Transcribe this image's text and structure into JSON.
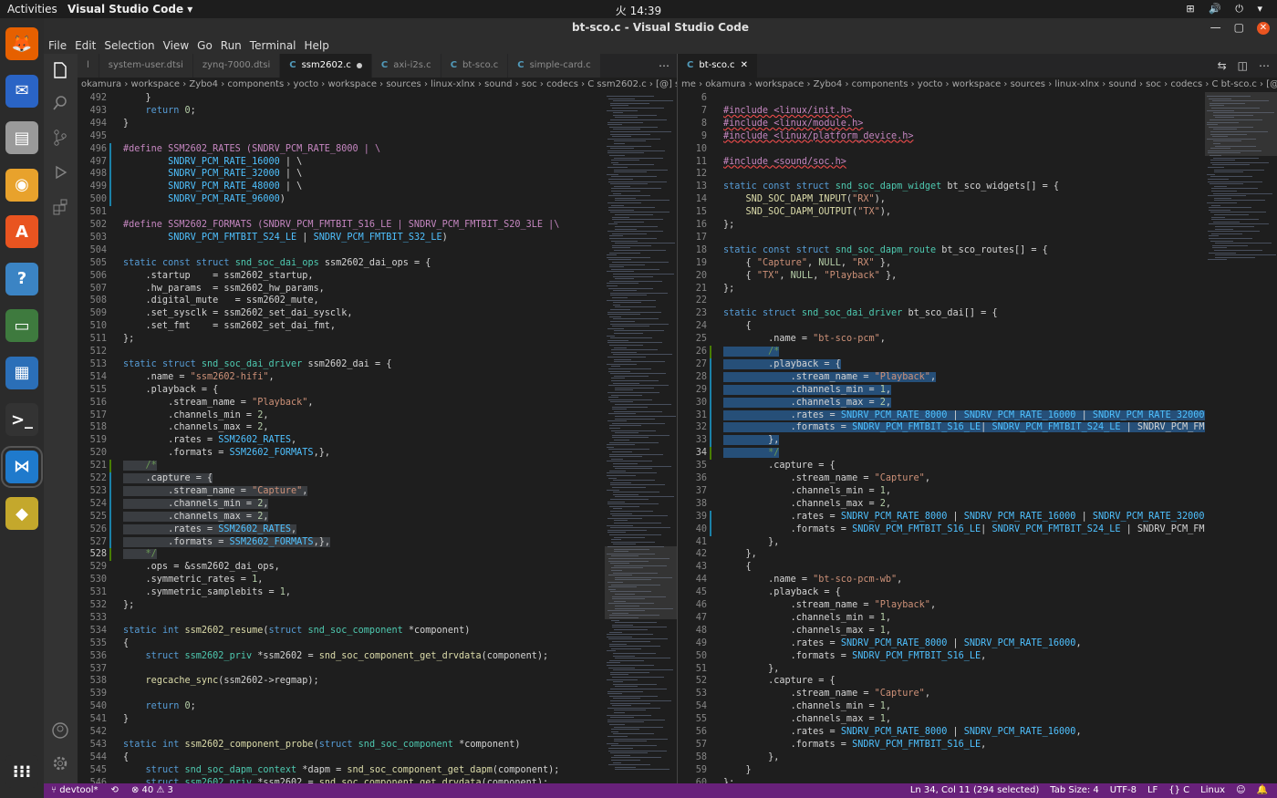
{
  "topbar": {
    "activities": "Activities",
    "app_menu": "Visual Studio Code ▾",
    "clock": "火 14:39",
    "tray": "⊞ 🔊 ⏻ ▾"
  },
  "window": {
    "title": "bt-sco.c - Visual Studio Code"
  },
  "menu": [
    "File",
    "Edit",
    "Selection",
    "View",
    "Go",
    "Run",
    "Terminal",
    "Help"
  ],
  "dock": [
    {
      "name": "firefox-icon",
      "glyph": "🦊",
      "color": "#e66000"
    },
    {
      "name": "thunderbird-icon",
      "glyph": "✉",
      "color": "#2a64c5"
    },
    {
      "name": "files-icon",
      "glyph": "▤",
      "color": "#9a9a9a"
    },
    {
      "name": "rhythmbox-icon",
      "glyph": "◉",
      "color": "#e8a22c"
    },
    {
      "name": "software-center-icon",
      "glyph": "A",
      "color": "#e95420"
    },
    {
      "name": "help-icon",
      "glyph": "?",
      "color": "#3b84c4"
    },
    {
      "name": "serial-port-icon",
      "glyph": "▭",
      "color": "#3e7a3e"
    },
    {
      "name": "libreoffice-writer-icon",
      "glyph": "▦",
      "color": "#2b6fb8"
    },
    {
      "name": "terminal-icon",
      "glyph": ">_",
      "color": "#333"
    },
    {
      "name": "vscode-icon",
      "glyph": "⋈",
      "color": "#1f7acc"
    },
    {
      "name": "vivado-icon",
      "glyph": "◆",
      "color": "#c4a82c"
    },
    {
      "name": "show-apps-icon",
      "glyph": "⁝⁝⁝",
      "color": "#2b2b2b"
    }
  ],
  "left": {
    "tabs": [
      {
        "label": "l",
        "active": false,
        "dirty": false
      },
      {
        "label": "system-user.dtsi",
        "active": false,
        "dirty": false
      },
      {
        "label": "zynq-7000.dtsi",
        "active": false,
        "dirty": false
      },
      {
        "label": "ssm2602.c",
        "active": true,
        "dirty": true
      },
      {
        "label": "axi-i2s.c",
        "active": false,
        "dirty": false
      },
      {
        "label": "bt-sco.c",
        "active": false,
        "dirty": false
      },
      {
        "label": "simple-card.c",
        "active": false,
        "dirty": false
      }
    ],
    "breadcrumb": "okamura › workspace › Zybo4 › components › yocto › workspace › sources › linux-xlnx › sound › soc › codecs ›  C ssm2602.c › [@] ssm2602_dai"
  },
  "right": {
    "tabs": [
      {
        "label": "bt-sco.c",
        "active": true,
        "dirty": false
      }
    ],
    "breadcrumb": "me › okamura › workspace › Zybo4 › components › yocto › workspace › sources › linux-xlnx › sound › soc › codecs ›  C bt-sco.c › [@] bt_sco_dai"
  },
  "status": {
    "branch": "devtool*",
    "sync": "⟲",
    "problems": "⊗ 40 ⚠ 3",
    "position": "Ln 34, Col 11 (294 selected)",
    "tab_size": "Tab Size: 4",
    "encoding": "UTF-8",
    "eol": "LF",
    "language": "{} C",
    "os": "Linux",
    "feedback": "☺",
    "bell": "🔔"
  }
}
